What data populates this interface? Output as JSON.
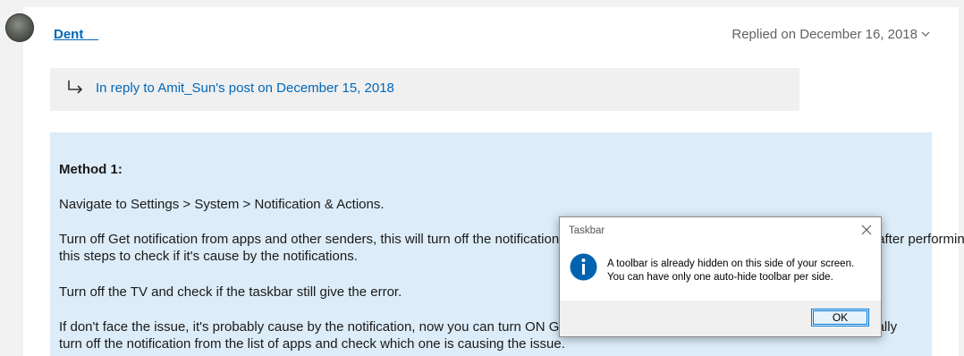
{
  "post": {
    "author": "Dent__",
    "replied": "Replied on December 16, 2018",
    "reply_to": "In reply to Amit_Sun's post on December 15, 2018",
    "method_heading": "Method 1:",
    "lines": [
      "Navigate to Settings > System > Notification & Actions.",
      "Turn off Get notification from apps and other senders, this will turn off the notifications for all apps. Check if the taskbar still gives the error after performing",
      "this steps to check if it's cause by the notifications.",
      "Turn off the TV and check if the taskbar still give the error.",
      "If don't face the issue, it's probably cause by the notification, now you can turn ON Get notification from apps and other senders and manually",
      "turn off the notification from the list of apps and check which one is causing the issue."
    ]
  },
  "dialog": {
    "title": "Taskbar",
    "message_line1": "A toolbar is already hidden on this side of your screen.",
    "message_line2": "You can have only one auto-hide toolbar per side.",
    "ok_label": "OK"
  },
  "colors": {
    "link": "#0067b8",
    "method_bg": "#dcecf8",
    "info_icon": "#0063b1"
  }
}
